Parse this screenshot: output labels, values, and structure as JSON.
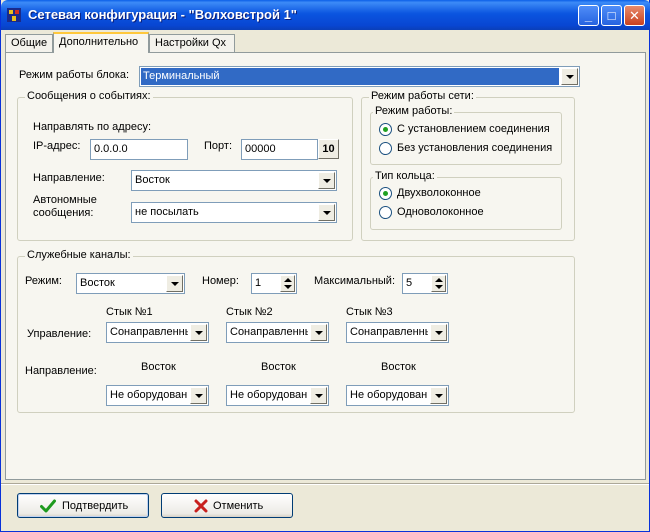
{
  "window": {
    "title": "Сетевая конфигурация - \"Волховстрой 1\"",
    "controls": {
      "minimize": "_",
      "maximize": "□",
      "close": "✕"
    }
  },
  "tabs": [
    {
      "label": "Общие"
    },
    {
      "label": "Дополнительно",
      "active": true
    },
    {
      "label": "Настройки Qx"
    }
  ],
  "block_mode": {
    "label": "Режим работы блока:",
    "value": "Терминальный"
  },
  "events": {
    "group_title": "Сообщения о событиях:",
    "send_to_label": "Направлять по адресу:",
    "ip_label": "IP-адрес:",
    "ip_value": "0.0.0.0",
    "port_label": "Порт:",
    "port_value": "00000",
    "keypad_label": "10",
    "direction_label": "Направление:",
    "direction_value": "Восток",
    "autonomous_label_1": "Автономные",
    "autonomous_label_2": "сообщения:",
    "autonomous_value": "не посылать"
  },
  "network_mode": {
    "group_title": "Режим работы сети:",
    "work_mode": {
      "title": "Режим работы:",
      "options": [
        {
          "label": "С установлением соединения",
          "checked": true
        },
        {
          "label": "Без установления соединения",
          "checked": false
        }
      ]
    },
    "ring_type": {
      "title": "Тип кольца:",
      "options": [
        {
          "label": "Двухволоконное",
          "checked": true
        },
        {
          "label": "Одноволоконное",
          "checked": false
        }
      ]
    }
  },
  "service_channels": {
    "group_title": "Служебные каналы:",
    "mode_label": "Режим:",
    "mode_value": "Восток",
    "number_label": "Номер:",
    "number_value": "1",
    "max_label": "Максимальный:",
    "max_value": "5",
    "control_label": "Управление:",
    "direction_label": "Направление:",
    "junctions": [
      {
        "title": "Стык №1",
        "control": "Сонаправленный",
        "direction_caption": "Восток",
        "direction": "Не оборудован"
      },
      {
        "title": "Стык №2",
        "control": "Сонаправленный",
        "direction_caption": "Восток",
        "direction": "Не оборудован"
      },
      {
        "title": "Стык №3",
        "control": "Сонаправленный",
        "direction_caption": "Восток",
        "direction": "Не оборудован"
      }
    ]
  },
  "buttons": {
    "confirm": {
      "label": "Подтвердить",
      "icon": "check-icon",
      "color": "#1E9A1E"
    },
    "cancel": {
      "label": "Отменить",
      "icon": "x-icon",
      "color": "#C8201E"
    }
  }
}
